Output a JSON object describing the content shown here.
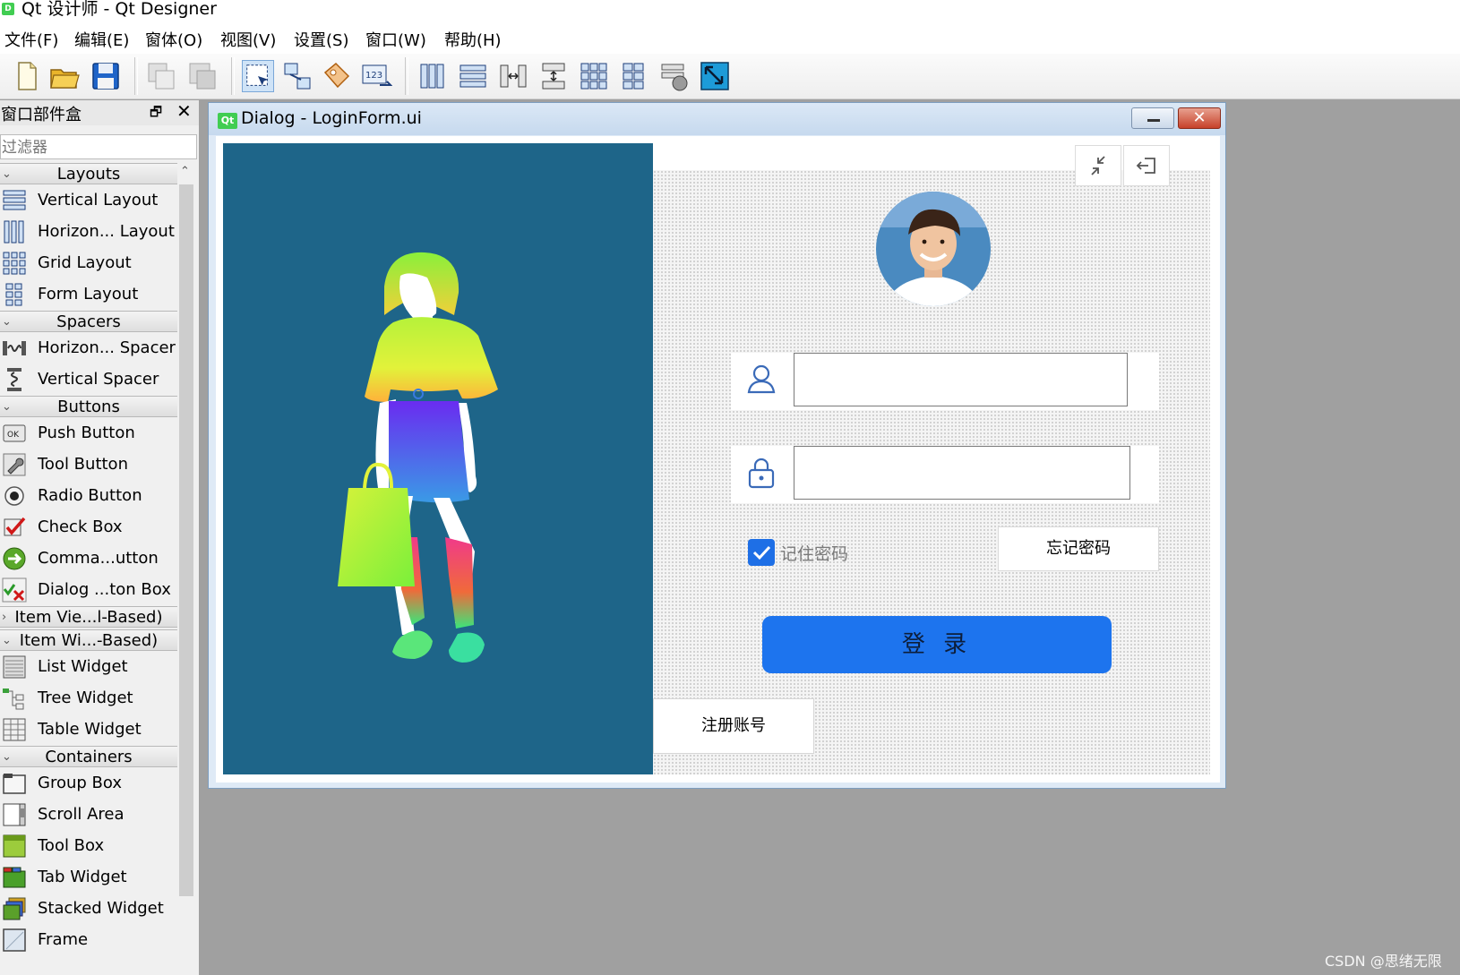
{
  "window": {
    "title": "Qt 设计师 - Qt Designer"
  },
  "menu": [
    "文件(F)",
    "编辑(E)",
    "窗体(O)",
    "视图(V)",
    "设置(S)",
    "窗口(W)",
    "帮助(H)"
  ],
  "widget_box": {
    "title": "窗口部件盒",
    "filter_placeholder": "过滤器",
    "categories": {
      "layouts": "Layouts",
      "spacers": "Spacers",
      "buttons": "Buttons",
      "item_views": "Item Vie...l-Based)",
      "item_widgets": "Item Wi...-Based)",
      "containers": "Containers"
    },
    "items": {
      "vertical_layout": "Vertical Layout",
      "horizontal_layout": "Horizon... Layout",
      "grid_layout": "Grid Layout",
      "form_layout": "Form Layout",
      "horizontal_spacer": "Horizon... Spacer",
      "vertical_spacer": "Vertical Spacer",
      "push_button": "Push Button",
      "tool_button": "Tool Button",
      "radio_button": "Radio Button",
      "check_box": "Check Box",
      "command_link": "Comma...utton",
      "dialog_button_box": "Dialog ...ton Box",
      "list_widget": "List Widget",
      "tree_widget": "Tree Widget",
      "table_widget": "Table Widget",
      "group_box": "Group Box",
      "scroll_area": "Scroll Area",
      "tool_box": "Tool Box",
      "tab_widget": "Tab Widget",
      "stacked_widget": "Stacked Widget",
      "frame": "Frame"
    }
  },
  "dialog": {
    "title": "Dialog - LoginForm.ui",
    "qt_badge": "Qt",
    "remember_label": "记住密码",
    "forgot_label": "忘记密码",
    "login_label": "登 录",
    "register_label": "注册账号",
    "username_value": "",
    "password_value": ""
  },
  "watermark": "CSDN @思绪无限",
  "colors": {
    "accent": "#1d74ee",
    "panel_bg": "#1e6589",
    "mdi_bg": "#a0a0a0"
  }
}
